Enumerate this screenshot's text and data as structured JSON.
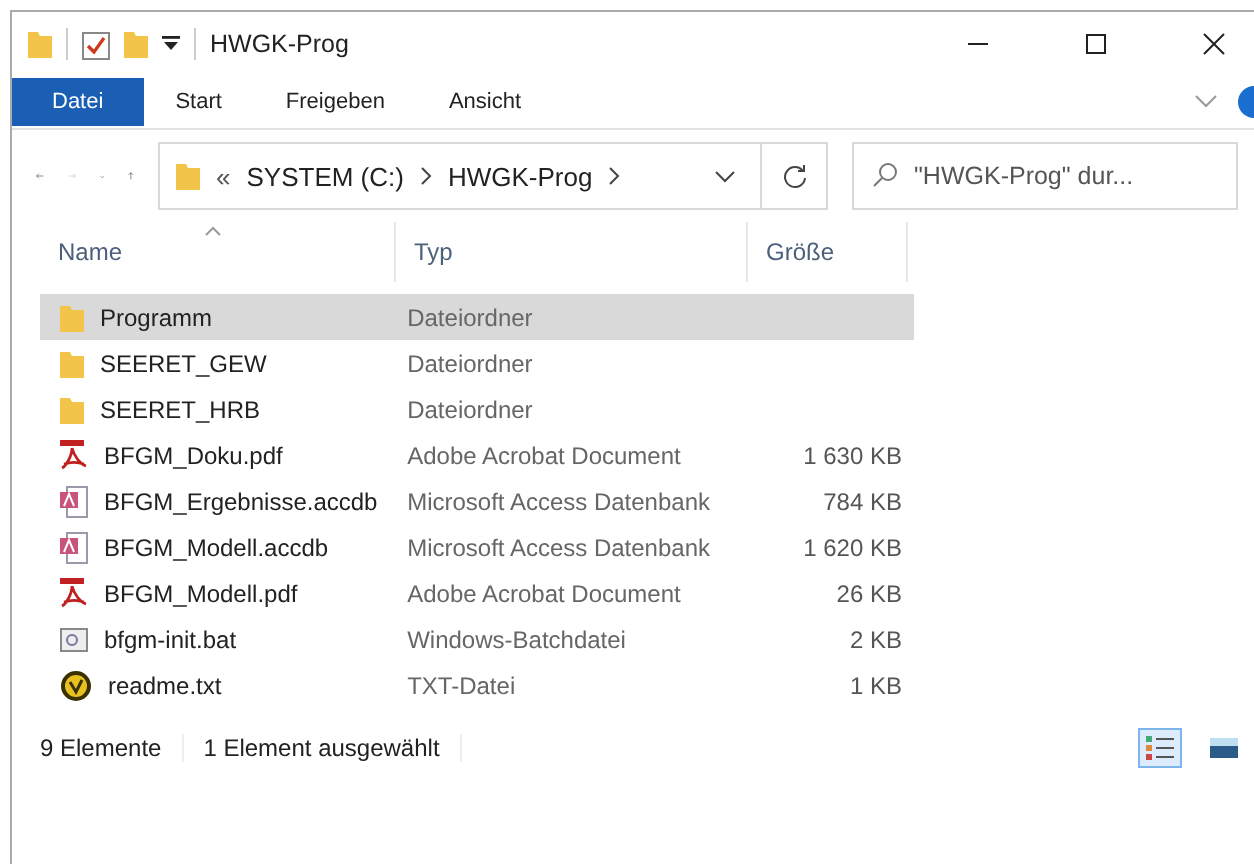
{
  "window": {
    "title": "HWGK-Prog"
  },
  "ribbon_tabs": [
    {
      "label": "Datei",
      "selected": true
    },
    {
      "label": "Start",
      "selected": false
    },
    {
      "label": "Freigeben",
      "selected": false
    },
    {
      "label": "Ansicht",
      "selected": false
    }
  ],
  "address": {
    "overflow": "«",
    "segments": [
      "SYSTEM (C:)",
      "HWGK-Prog"
    ]
  },
  "search": {
    "placeholder": "\"HWGK-Prog\" dur..."
  },
  "columns": [
    "Name",
    "Typ",
    "Größe"
  ],
  "rows": [
    {
      "name": "Programm",
      "type": "Dateiordner",
      "size": "",
      "kind": "folder",
      "selected": true
    },
    {
      "name": "SEERET_GEW",
      "type": "Dateiordner",
      "size": "",
      "kind": "folder",
      "selected": false
    },
    {
      "name": "SEERET_HRB",
      "type": "Dateiordner",
      "size": "",
      "kind": "folder",
      "selected": false
    },
    {
      "name": "BFGM_Doku.pdf",
      "type": "Adobe Acrobat Document",
      "size": "1 630 KB",
      "kind": "pdf",
      "selected": false
    },
    {
      "name": "BFGM_Ergebnisse.accdb",
      "type": "Microsoft Access Datenbank",
      "size": "784 KB",
      "kind": "access",
      "selected": false
    },
    {
      "name": "BFGM_Modell.accdb",
      "type": "Microsoft Access Datenbank",
      "size": "1 620 KB",
      "kind": "access",
      "selected": false
    },
    {
      "name": "BFGM_Modell.pdf",
      "type": "Adobe Acrobat Document",
      "size": "26 KB",
      "kind": "pdf",
      "selected": false
    },
    {
      "name": "bfgm-init.bat",
      "type": "Windows-Batchdatei",
      "size": "2 KB",
      "kind": "bat",
      "selected": false
    },
    {
      "name": "readme.txt",
      "type": "TXT-Datei",
      "size": "1 KB",
      "kind": "txt",
      "selected": false
    }
  ],
  "status_bar": {
    "count": "9 Elemente",
    "selection": "1 Element ausgewählt"
  },
  "view_buttons": [
    {
      "kind": "details",
      "selected": true
    },
    {
      "kind": "tiles",
      "selected": false
    }
  ]
}
